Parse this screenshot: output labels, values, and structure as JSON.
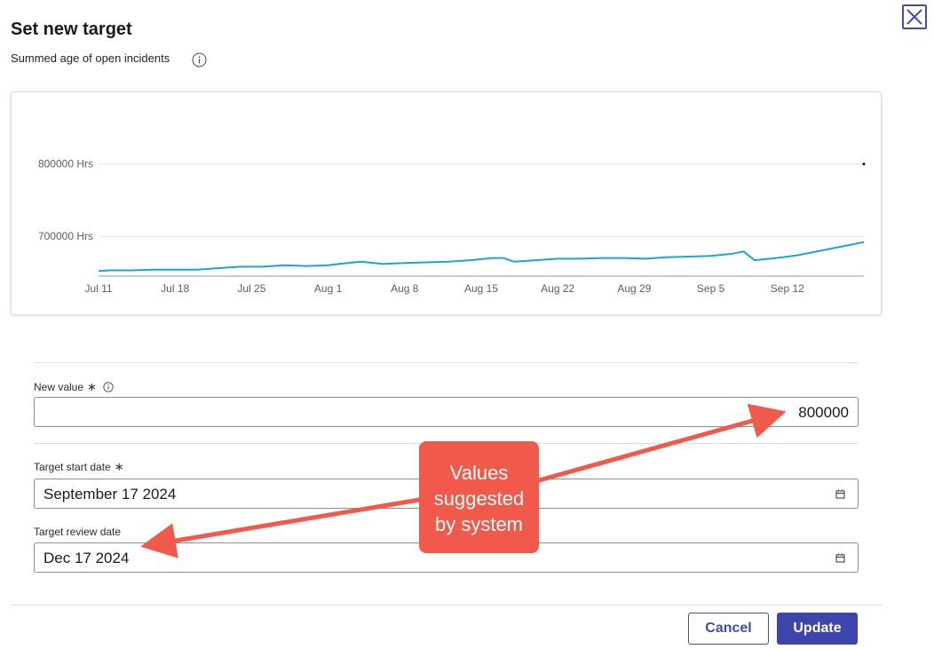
{
  "dialog": {
    "title": "Set new target",
    "subtitle": "Summed age of open incidents",
    "close_icon": "close-x-icon",
    "info_icon": "info-circle-icon"
  },
  "chart_data": {
    "type": "line",
    "title": "",
    "xlabel": "",
    "ylabel": "",
    "x_tick_labels": [
      "Jul 11",
      "Jul 18",
      "Jul 25",
      "Aug 1",
      "Aug 8",
      "Aug 15",
      "Aug 22",
      "Aug 29",
      "Sep 5",
      "Sep 12"
    ],
    "y_tick_labels": [
      "800000 Hrs",
      "700000 Hrs"
    ],
    "y_ticks": [
      800000,
      700000
    ],
    "ylim": [
      645000,
      850000
    ],
    "x_start_label": "Jul 11",
    "x_end_day": 70,
    "grid": "horizontal",
    "line_color": "#1aa6d4",
    "target_marker": {
      "day": 70,
      "value": 800000
    },
    "series": [
      {
        "x": [
          0,
          1,
          3,
          5,
          7,
          9,
          11,
          13,
          15,
          17,
          19,
          21,
          22,
          24,
          26,
          28,
          30,
          32,
          34,
          36,
          37,
          38,
          40,
          42,
          44,
          46,
          48,
          50,
          52,
          54,
          56,
          58,
          59,
          60,
          62,
          64,
          66,
          68,
          70
        ],
        "y": [
          652000,
          653000,
          653000,
          654000,
          654000,
          654000,
          656000,
          658000,
          658000,
          660000,
          659000,
          660000,
          662000,
          665000,
          662000,
          663000,
          664000,
          665000,
          667000,
          670000,
          670000,
          665000,
          667000,
          669000,
          669000,
          670000,
          670000,
          669000,
          671000,
          672000,
          673000,
          676000,
          679000,
          667000,
          670000,
          674000,
          680000,
          686000,
          692000
        ]
      }
    ]
  },
  "form": {
    "new_value": {
      "label": "New value",
      "required_mark": "∗",
      "value": "800000"
    },
    "start_date": {
      "label": "Target start date",
      "required_mark": "∗",
      "value": "September 17 2024"
    },
    "review_date": {
      "label": "Target review date",
      "value": "Dec 17 2024"
    },
    "calendar_icon": "calendar-icon"
  },
  "annotation": {
    "lines": [
      "Values",
      "suggested",
      "by system"
    ],
    "color": "#f15a4a"
  },
  "buttons": {
    "cancel": "Cancel",
    "update": "Update"
  },
  "colors": {
    "accent": "#3f44ad",
    "annotation": "#f15a4a"
  }
}
